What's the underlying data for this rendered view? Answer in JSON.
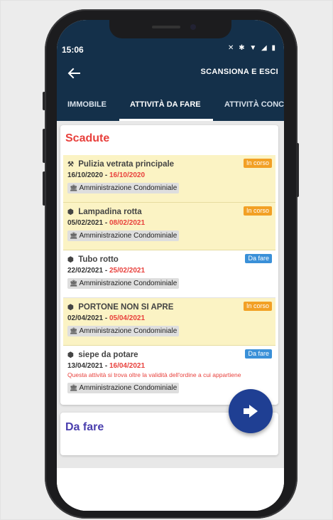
{
  "status_bar": {
    "time": "15:06",
    "icons": "✕ ✱ ▼ ◢ ▮"
  },
  "app_bar": {
    "back_icon": "arrow-left-icon",
    "action_label": "SCANSIONA E ESCI"
  },
  "tabs": [
    {
      "label": "IMMOBILE",
      "active": false
    },
    {
      "label": "ATTIVITÀ DA FARE",
      "active": true
    },
    {
      "label": "ATTIVITÀ CONC",
      "active": false
    }
  ],
  "sections": {
    "expired": {
      "title": "Scadute",
      "tasks": [
        {
          "title": "Pulizia vetrata principale",
          "start": "16/10/2020",
          "end": "16/10/2020",
          "status": "In corso",
          "owner": "Amministrazione Condominiale",
          "icon": "tools-icon"
        },
        {
          "title": "Lampadina rotta",
          "start": "05/02/2021",
          "end": "08/02/2021",
          "status": "In corso",
          "owner": "Amministrazione Condominiale",
          "icon": "box-icon"
        },
        {
          "title": "Tubo rotto",
          "start": "22/02/2021",
          "end": "25/02/2021",
          "status": "Da fare",
          "owner": "Amministrazione Condominiale",
          "icon": "box-icon"
        },
        {
          "title": "PORTONE NON SI APRE",
          "start": "02/04/2021",
          "end": "05/04/2021",
          "status": "In corso",
          "owner": "Amministrazione Condominiale",
          "icon": "box-icon"
        },
        {
          "title": "siepe da potare",
          "start": "13/04/2021",
          "end": "16/04/2021",
          "status": "Da fare",
          "owner": "Amministrazione Condominiale",
          "icon": "box-icon",
          "warning": "Questa attività si trova oltre la validità dell'ordine a cui appartiene"
        }
      ]
    },
    "todo": {
      "title": "Da fare"
    }
  },
  "date_separator": " - ",
  "fab": {
    "icon": "exit-icon"
  },
  "colors": {
    "primary": "#14304a",
    "expired_title": "#e8403c",
    "todo_title": "#4a3fae",
    "in_progress": "#f2a024",
    "to_do": "#3a90d8",
    "fab": "#1f3f93"
  }
}
